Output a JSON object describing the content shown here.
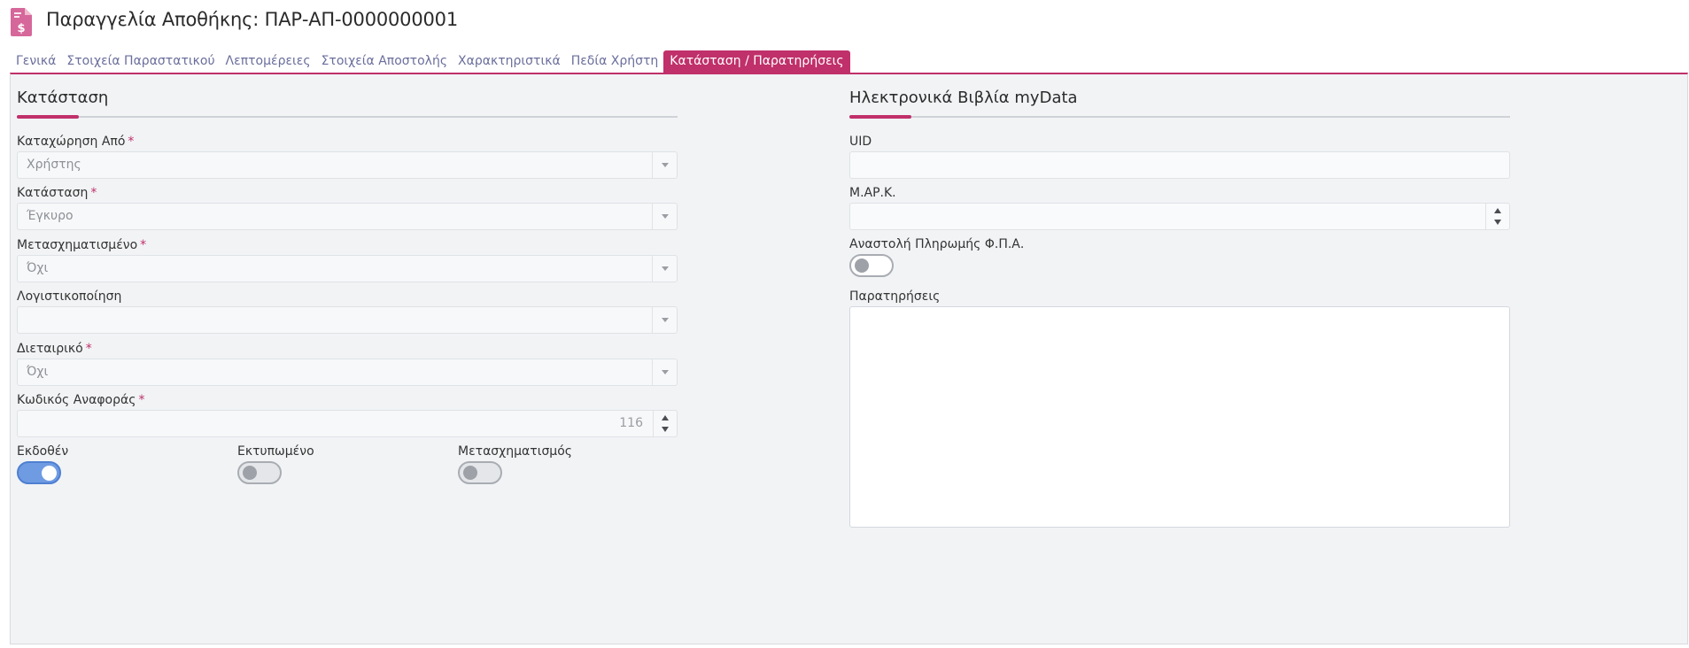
{
  "header": {
    "title": "Παραγγελία Αποθήκης: ΠΑΡ-ΑΠ-0000000001",
    "icon": "document-dollar-icon",
    "accent_color": "#c0306a"
  },
  "tabs": [
    {
      "label": "Γενικά",
      "active": false
    },
    {
      "label": "Στοιχεία Παραστατικού",
      "active": false
    },
    {
      "label": "Λεπτομέρειες",
      "active": false
    },
    {
      "label": "Στοιχεία Αποστολής",
      "active": false
    },
    {
      "label": "Χαρακτηριστικά",
      "active": false
    },
    {
      "label": "Πεδία Χρήστη",
      "active": false
    },
    {
      "label": "Κατάσταση / Παρατηρήσεις",
      "active": true
    }
  ],
  "status_section": {
    "title": "Κατάσταση",
    "fields": {
      "registered_by": {
        "label": "Καταχώρηση Από",
        "required_mark": "*",
        "value": "Χρήστης"
      },
      "status": {
        "label": "Κατάσταση",
        "required_mark": "*",
        "value": "Έγκυρο"
      },
      "transformed": {
        "label": "Μετασχηματισμένο",
        "required_mark": "*",
        "value": "Όχι"
      },
      "accounting": {
        "label": "Λογιστικοποίηση",
        "value": ""
      },
      "intercompany": {
        "label": "Διεταιρικό",
        "required_mark": "*",
        "value": "Όχι"
      },
      "reference_code": {
        "label": "Κωδικός Αναφοράς",
        "required_mark": "*",
        "value": "116"
      }
    },
    "toggles": {
      "issued": {
        "label": "Εκδοθέν",
        "on": true
      },
      "printed": {
        "label": "Εκτυπωμένο",
        "on": false
      },
      "transformation": {
        "label": "Μετασχηματισμός",
        "on": false
      }
    }
  },
  "mydata_section": {
    "title": "Ηλεκτρονικά Βιβλία myData",
    "fields": {
      "uid": {
        "label": "UID",
        "value": ""
      },
      "mark": {
        "label": "Μ.ΑΡ.Κ.",
        "value": ""
      },
      "vat_suspension": {
        "label": "Αναστολή Πληρωμής Φ.Π.Α.",
        "on": false
      },
      "notes": {
        "label": "Παρατηρήσεις",
        "value": ""
      }
    }
  }
}
